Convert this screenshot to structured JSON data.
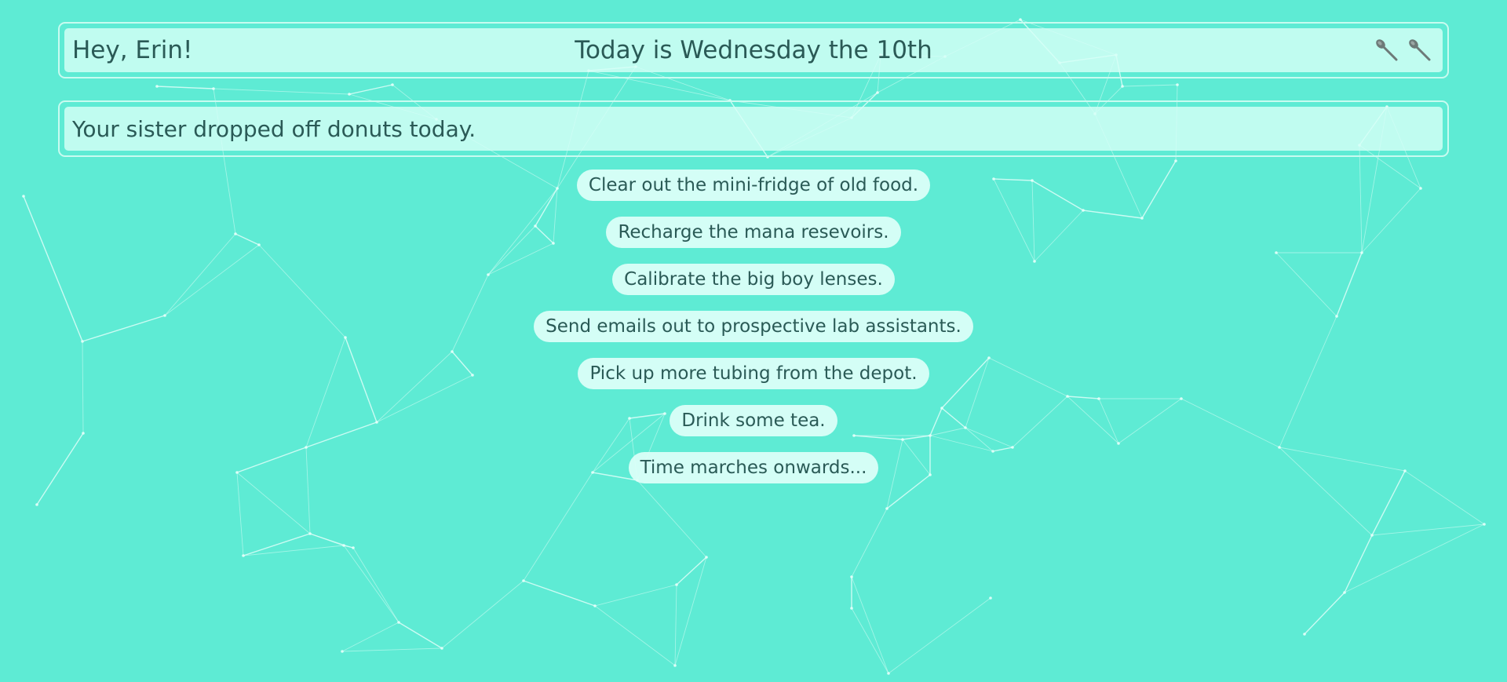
{
  "header": {
    "greeting": "Hey, Erin!",
    "date_text": "Today is Wednesday the 10th",
    "tools": [
      {
        "icon": "spoon-icon"
      },
      {
        "icon": "spoon-icon"
      }
    ]
  },
  "notice": {
    "text": "Your sister dropped off donuts today."
  },
  "tasks": [
    "Clear out the mini-fridge of old food.",
    "Recharge the mana resevoirs.",
    "Calibrate the big boy lenses.",
    "Send emails out to prospective lab assistants.",
    "Pick up more tubing from the depot.",
    "Drink some tea.",
    "Time marches onwards..."
  ],
  "colors": {
    "background": "#5eebd4",
    "panel": "#d6fff6",
    "text": "#2a5a56",
    "network_lines": "#e6fffa"
  }
}
